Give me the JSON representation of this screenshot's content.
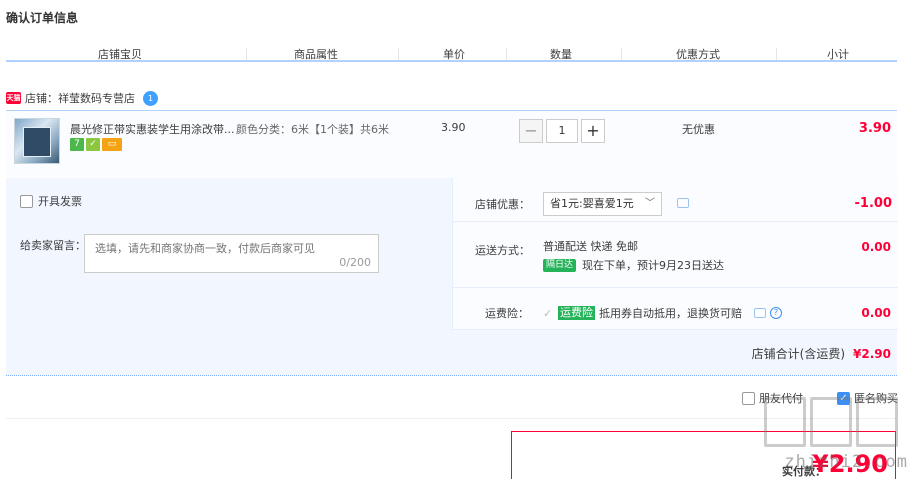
{
  "page": {
    "title": "确认订单信息"
  },
  "columns": [
    "店铺宝贝",
    "商品属性",
    "单价",
    "数量",
    "优惠方式",
    "小计"
  ],
  "shop": {
    "logo_text": "天猫",
    "label": "店铺：祥莹数码专营店",
    "chat_badge": "1"
  },
  "item": {
    "name": "晨光修正带实惠装学生用涂改带...",
    "attributes": "颜色分类：6米【1个装】共6米",
    "price": "3.90",
    "qty": "1",
    "qty_minus": "−",
    "qty_plus": "+",
    "discount": "无优惠",
    "subtotal": "3.90",
    "badges": [
      "7",
      "",
      ""
    ]
  },
  "extras": {
    "invoice_label": "开具发票",
    "message_label": "给卖家留言：",
    "message_placeholder": "选填，请先和商家协商一致，付款后商家可见",
    "message_count": "0/200",
    "store_discount_label": "店铺优惠：",
    "store_discount_selected": "省1元:婴喜爱1元",
    "store_discount_value": "-1.00",
    "shipping_label": "运送方式：",
    "shipping_text": "普通配送 快递 免邮",
    "shipping_badge": "隔日达",
    "shipping_eta": "现在下单，预计9月23日送达",
    "shipping_value": "0.00",
    "insurance_label": "运费险：",
    "insurance_tag": "运费险",
    "insurance_text": "抵用券自动抵用，退换货可赔",
    "insurance_value": "0.00",
    "store_total_label": "店铺合计(含运费)",
    "store_total_value": "¥2.90"
  },
  "options": {
    "friend_pay": "朋友代付",
    "anonymous": "匿名购买"
  },
  "payment": {
    "label": "实付款：",
    "value": "¥2.90"
  },
  "watermark": {
    "text": "zhizhi2.com"
  },
  "colors": {
    "price_red": "#ff0036",
    "accent_blue": "#3d8ff2",
    "green": "#25b35a"
  }
}
